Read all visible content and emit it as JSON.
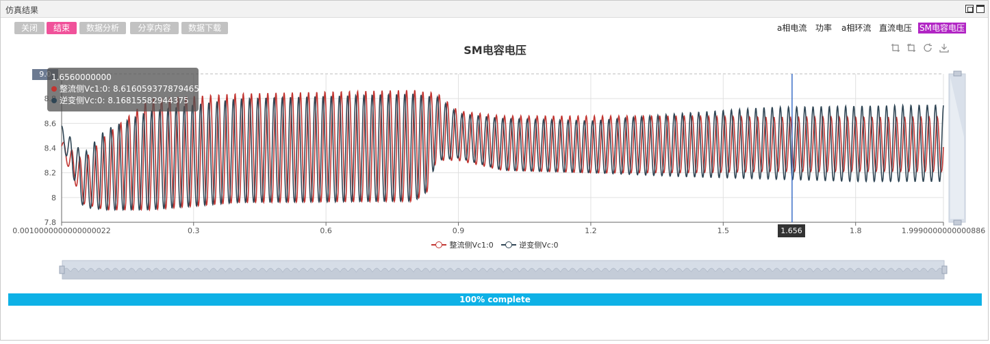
{
  "window": {
    "title": "仿真结果"
  },
  "toolbar": {
    "close": "关闭",
    "end": "结束",
    "analysis": "数据分析",
    "share": "分享内容",
    "download": "数据下载"
  },
  "tabs": [
    "a相电流",
    "功率",
    "a相环流",
    "直流电压",
    "SM电容电压"
  ],
  "active_tab": "SM电容电压",
  "colors": {
    "series1": "#c23531",
    "series2": "#2f4554",
    "cursor": "#3b6fc7",
    "progress": "#0eb1e6",
    "active_tab": "#b125c4",
    "end_button": "#f0529a"
  },
  "tool_icons": [
    "zoom-icon",
    "zoom-back-icon",
    "restore-icon",
    "save-image-icon"
  ],
  "tooltip": {
    "x": "1.6560000000",
    "line1": "整流侧Vc1:0: 8.616059377879465",
    "line2": "逆变侧Vc:0: 8.16815582944375"
  },
  "axis_pointer": {
    "x_label": "1.656",
    "y_label": "9.0"
  },
  "progress": {
    "value": 1.0,
    "label": "100% complete"
  },
  "chart_data": {
    "type": "line",
    "title": "SM电容电压",
    "xlabel": "",
    "ylabel": "",
    "xlim": [
      0.001,
      1.999
    ],
    "ylim": [
      7.8,
      9.0
    ],
    "x_tick_labels": [
      "0.0010000000000000022",
      "0.3",
      "0.6",
      "0.9",
      "1.2",
      "1.5",
      "1.8",
      "1.9990000000000886"
    ],
    "y_tick_labels": [
      "7.8",
      "8",
      "8.2",
      "8.4",
      "8.6",
      "8.8",
      "9.0"
    ],
    "grid": true,
    "legend_position": "bottom-center",
    "cursor_x": 1.656,
    "series": [
      {
        "name": "整流侧Vc1:0",
        "description_envelope": [
          [
            0.001,
            8.38,
            8.46
          ],
          [
            0.05,
            7.95,
            8.3
          ],
          [
            0.1,
            7.9,
            8.5
          ],
          [
            0.2,
            7.9,
            8.8
          ],
          [
            0.4,
            7.96,
            8.84
          ],
          [
            0.8,
            7.97,
            8.87
          ],
          [
            0.83,
            8.05,
            8.85
          ],
          [
            0.85,
            8.3,
            8.85
          ],
          [
            0.9,
            8.3,
            8.7
          ],
          [
            1.0,
            8.22,
            8.66
          ],
          [
            1.2,
            8.2,
            8.66
          ],
          [
            1.4,
            8.2,
            8.66
          ],
          [
            1.6,
            8.21,
            8.65
          ],
          [
            1.8,
            8.21,
            8.65
          ],
          [
            1.999,
            8.21,
            8.65
          ]
        ],
        "cycles": 108
      },
      {
        "name": "逆变侧Vc:0",
        "description_envelope": [
          [
            0.001,
            8.45,
            8.58
          ],
          [
            0.05,
            7.92,
            8.35
          ],
          [
            0.1,
            7.9,
            8.55
          ],
          [
            0.2,
            7.9,
            8.7
          ],
          [
            0.4,
            7.96,
            8.8
          ],
          [
            0.8,
            7.97,
            8.84
          ],
          [
            0.83,
            8.05,
            8.82
          ],
          [
            0.85,
            8.3,
            8.82
          ],
          [
            0.9,
            8.32,
            8.68
          ],
          [
            1.0,
            8.22,
            8.64
          ],
          [
            1.2,
            8.2,
            8.62
          ],
          [
            1.4,
            8.17,
            8.68
          ],
          [
            1.6,
            8.15,
            8.73
          ],
          [
            1.8,
            8.13,
            8.74
          ],
          [
            1.999,
            8.13,
            8.75
          ]
        ],
        "cycles": 108
      }
    ]
  }
}
